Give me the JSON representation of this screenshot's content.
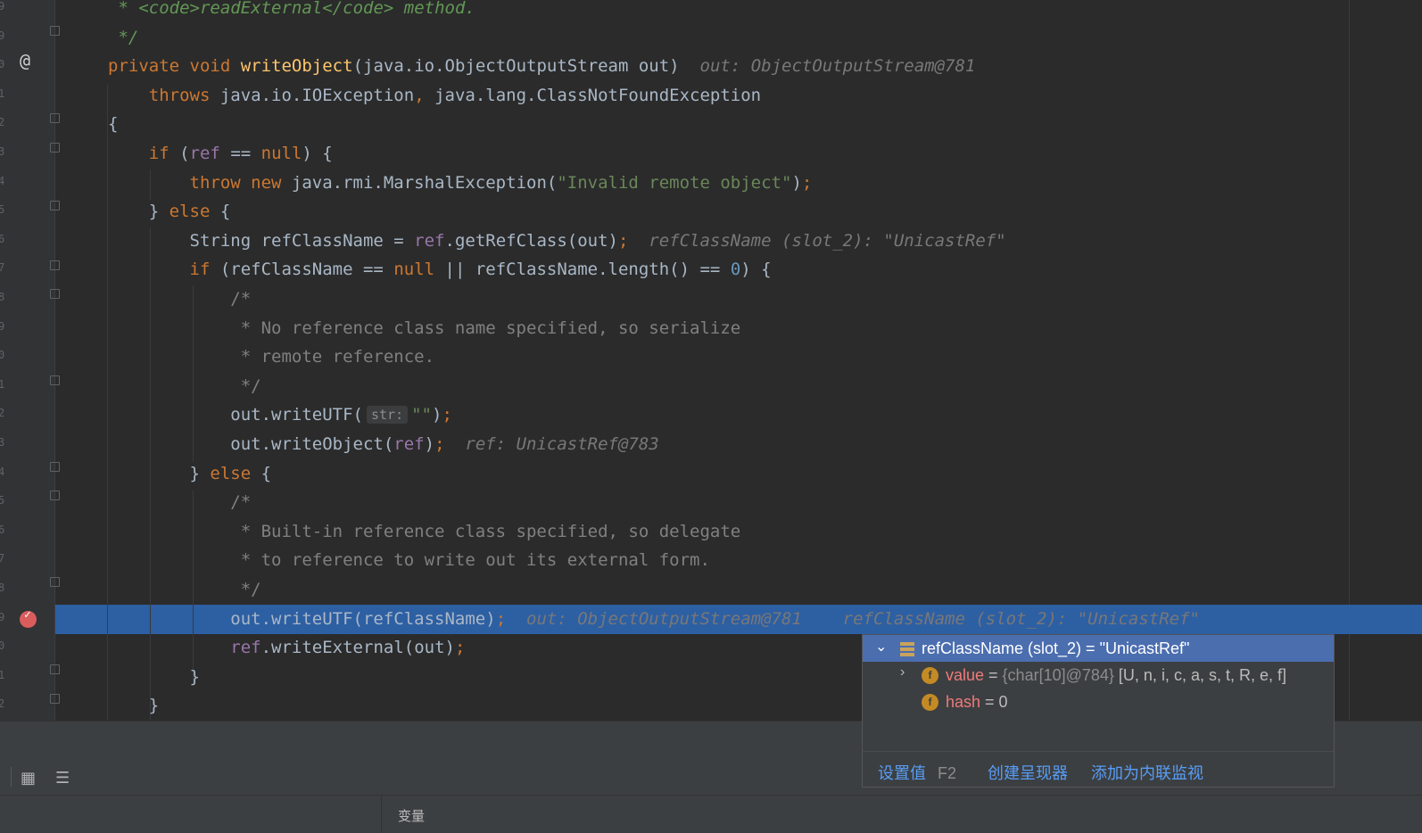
{
  "editor": {
    "lines": [
      {
        "n": "9",
        "parts": [
          {
            "t": " * ",
            "c": "doc"
          },
          {
            "t": "<code>",
            "c": "doc"
          },
          {
            "t": "readExternal",
            "c": "doc"
          },
          {
            "t": "</code>",
            "c": "doc"
          },
          {
            "t": " method.",
            "c": "doc"
          }
        ]
      },
      {
        "n": "9",
        "parts": [
          {
            "t": " */",
            "c": "doc"
          }
        ]
      },
      {
        "n": "0",
        "parts": [
          {
            "t": "private void ",
            "c": "kw"
          },
          {
            "t": "writeObject",
            "c": "fn"
          },
          {
            "t": "(java.io.ObjectOutputStream out)  ",
            "c": ""
          },
          {
            "t": "out: ObjectOutputStream@781",
            "c": "inlay"
          }
        ]
      },
      {
        "n": "1",
        "parts": [
          {
            "t": "    throws ",
            "c": "kw"
          },
          {
            "t": "java.io.IOException",
            "c": ""
          },
          {
            "t": ", ",
            "c": "kw"
          },
          {
            "t": "java.lang.ClassNotFoundException",
            "c": ""
          }
        ]
      },
      {
        "n": "2",
        "parts": [
          {
            "t": "{",
            "c": ""
          }
        ]
      },
      {
        "n": "3",
        "parts": [
          {
            "t": "    ",
            "c": ""
          },
          {
            "t": "if ",
            "c": "kw"
          },
          {
            "t": "(",
            "c": ""
          },
          {
            "t": "ref",
            "c": "field"
          },
          {
            "t": " == ",
            "c": ""
          },
          {
            "t": "null",
            "c": "kw"
          },
          {
            "t": ") {",
            "c": ""
          }
        ]
      },
      {
        "n": "4",
        "parts": [
          {
            "t": "        ",
            "c": ""
          },
          {
            "t": "throw new ",
            "c": "kw"
          },
          {
            "t": "java.rmi.MarshalException(",
            "c": ""
          },
          {
            "t": "\"Invalid remote object\"",
            "c": "str"
          },
          {
            "t": ")",
            "c": ""
          },
          {
            "t": ";",
            "c": "kw"
          }
        ]
      },
      {
        "n": "5",
        "parts": [
          {
            "t": "    } ",
            "c": ""
          },
          {
            "t": "else ",
            "c": "kw"
          },
          {
            "t": "{",
            "c": ""
          }
        ]
      },
      {
        "n": "6",
        "parts": [
          {
            "t": "        String refClassName = ",
            "c": ""
          },
          {
            "t": "ref",
            "c": "field"
          },
          {
            "t": ".getRefClass(out)",
            "c": ""
          },
          {
            "t": ";  ",
            "c": "kw"
          },
          {
            "t": "refClassName (slot_2): \"UnicastRef\"",
            "c": "inlay"
          }
        ]
      },
      {
        "n": "7",
        "parts": [
          {
            "t": "        ",
            "c": ""
          },
          {
            "t": "if ",
            "c": "kw"
          },
          {
            "t": "(refClassName == ",
            "c": ""
          },
          {
            "t": "null",
            "c": "kw"
          },
          {
            "t": " || refClassName.length() == ",
            "c": ""
          },
          {
            "t": "0",
            "c": "num"
          },
          {
            "t": ") {",
            "c": ""
          }
        ]
      },
      {
        "n": "8",
        "parts": [
          {
            "t": "            /*",
            "c": "cmt"
          }
        ]
      },
      {
        "n": "9",
        "parts": [
          {
            "t": "             * No reference class name specified, so serialize",
            "c": "cmt"
          }
        ]
      },
      {
        "n": "0",
        "parts": [
          {
            "t": "             * remote reference.",
            "c": "cmt"
          }
        ]
      },
      {
        "n": "1",
        "parts": [
          {
            "t": "             */",
            "c": "cmt"
          }
        ]
      },
      {
        "n": "2",
        "parts": [
          {
            "t": "            out.writeUTF(",
            "c": ""
          },
          {
            "t": "str:",
            "c": "hint"
          },
          {
            "t": "\"\"",
            "c": "str"
          },
          {
            "t": ")",
            "c": ""
          },
          {
            "t": ";",
            "c": "kw"
          }
        ]
      },
      {
        "n": "3",
        "parts": [
          {
            "t": "            out.writeObject(",
            "c": ""
          },
          {
            "t": "ref",
            "c": "field"
          },
          {
            "t": ")",
            "c": ""
          },
          {
            "t": ";  ",
            "c": "kw"
          },
          {
            "t": "ref: UnicastRef@783",
            "c": "inlay"
          }
        ]
      },
      {
        "n": "4",
        "parts": [
          {
            "t": "        } ",
            "c": ""
          },
          {
            "t": "else ",
            "c": "kw"
          },
          {
            "t": "{",
            "c": ""
          }
        ]
      },
      {
        "n": "5",
        "parts": [
          {
            "t": "            /*",
            "c": "cmt"
          }
        ]
      },
      {
        "n": "6",
        "parts": [
          {
            "t": "             * Built-in reference class specified, so delegate",
            "c": "cmt"
          }
        ]
      },
      {
        "n": "7",
        "parts": [
          {
            "t": "             * to reference to write out its external form.",
            "c": "cmt"
          }
        ]
      },
      {
        "n": "8",
        "parts": [
          {
            "t": "             */",
            "c": "cmt"
          }
        ]
      },
      {
        "n": "9",
        "parts": [
          {
            "t": "            out.writeUTF(refClassName)",
            "c": ""
          },
          {
            "t": ";  ",
            "c": "kw"
          },
          {
            "t": "out: ObjectOutputStream@781    refClassName (slot_2): \"UnicastRef\"",
            "c": "inlay"
          }
        ]
      },
      {
        "n": "0",
        "parts": [
          {
            "t": "            ",
            "c": ""
          },
          {
            "t": "ref",
            "c": "field"
          },
          {
            "t": ".writeExternal(out)",
            "c": ""
          },
          {
            "t": ";",
            "c": "kw"
          }
        ]
      },
      {
        "n": "1",
        "parts": [
          {
            "t": "        }",
            "c": ""
          }
        ]
      },
      {
        "n": "2",
        "parts": [
          {
            "t": "    }",
            "c": ""
          }
        ]
      }
    ]
  },
  "gutter": {
    "override_marker": "@"
  },
  "popup": {
    "root": "refClassName (slot_2) = \"UnicastRef\"",
    "value_name": "value",
    "value_eq": " = ",
    "value_type": "{char[10]@784}",
    "value_val": " [U, n, i, c, a, s, t, R, e, f]",
    "hash_name": "hash",
    "hash_eq": " = 0",
    "set_value": "设置值",
    "set_value_key": "F2",
    "create_renderer": "创建呈现器",
    "add_inline_watch": "添加为内联监视"
  },
  "bottom": {
    "variables_tab": "变量"
  }
}
